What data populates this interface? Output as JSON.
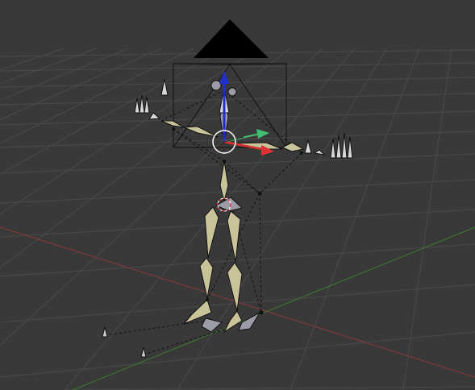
{
  "viewport": {
    "background": "#393939",
    "grid_color": "#4a4a4a",
    "x_axis_color": "#8a3a3a",
    "y_axis_color": "#3f7a2e",
    "bone_fill": "#c9c39a",
    "bone_selected_fill": "#9c9ca8",
    "relationship_line_color": "#111111"
  },
  "gizmo": {
    "x_color": "#e03030",
    "y_color": "#40c070",
    "z_color": "#2030d0",
    "pivot_color": "#ffffff"
  },
  "icons": {
    "camera": "camera-icon",
    "manipulator": "transform-manipulator-icon",
    "pivot": "3d-cursor-icon"
  }
}
